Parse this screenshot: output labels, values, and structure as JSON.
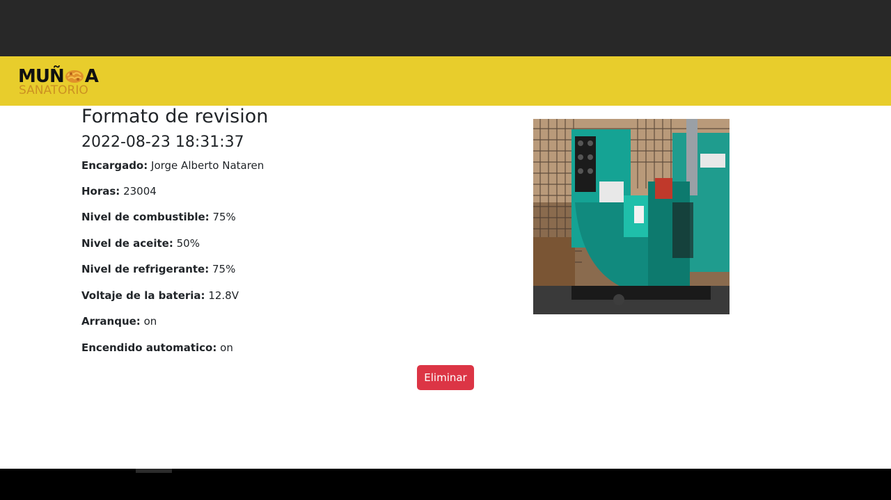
{
  "brand": {
    "logo_left": "MUÑ",
    "logo_right": "A",
    "logo_sub": "SANATORIO",
    "accent_color": "#e8cd2c",
    "logo_mark_color": "#e0912a"
  },
  "record": {
    "title": "Formato de revision",
    "datetime": "2022-08-23 18:31:37",
    "fields": [
      {
        "label": "Encargado:",
        "value": "Jorge Alberto Nataren"
      },
      {
        "label": "Horas:",
        "value": "23004"
      },
      {
        "label": "Nivel de combustible:",
        "value": "75%"
      },
      {
        "label": "Nivel de aceite:",
        "value": "50%"
      },
      {
        "label": "Nivel de refrigerante:",
        "value": "75%"
      },
      {
        "label": "Voltaje de la bateria:",
        "value": "12.8V"
      },
      {
        "label": "Arranque:",
        "value": "on"
      },
      {
        "label": "Encendido automatico:",
        "value": "on"
      }
    ]
  },
  "photo": {
    "icon": "generator-photo"
  },
  "actions": {
    "delete_label": "Eliminar",
    "delete_color": "#dc3545"
  }
}
